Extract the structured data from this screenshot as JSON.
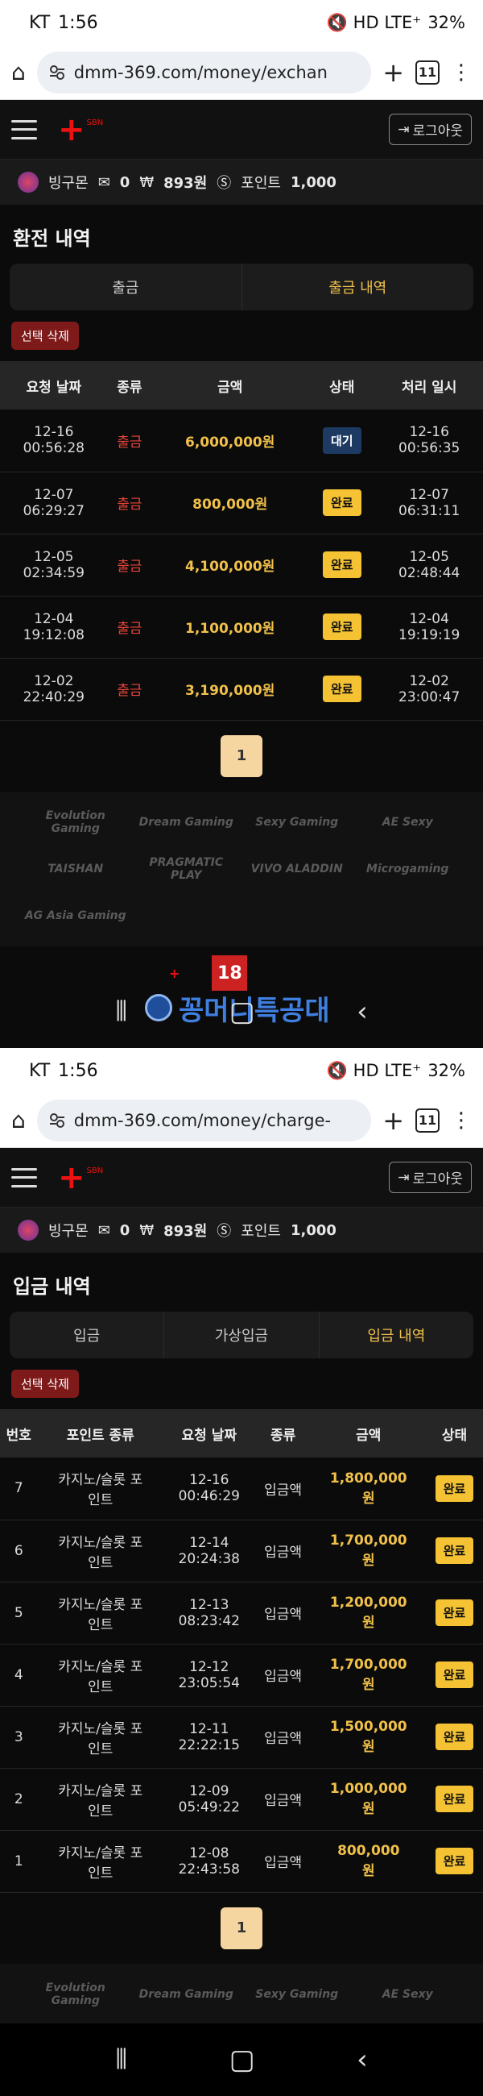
{
  "status_bar": {
    "screen1": {
      "carrier": "KT",
      "time": "1:56",
      "icons": "🔇 HD LTE⁺",
      "battery": "32%"
    },
    "screen2": {
      "carrier": "KT",
      "time": "1:56",
      "icons": "🔇 HD LTE⁺",
      "battery": "32%"
    }
  },
  "browser": {
    "screen1_url": "dmm-369.com/money/exchan",
    "screen2_url": "dmm-369.com/money/charge-",
    "tab_count": "11"
  },
  "header": {
    "logo_sub": "SBN",
    "logout_label": "로그아웃"
  },
  "user": {
    "name": "빙구몬",
    "messages": "0",
    "money": "893원",
    "point_label": "포인트",
    "points": "1,000"
  },
  "exchange": {
    "title": "환전 내역",
    "tabs": [
      "출금",
      "출금 내역"
    ],
    "delete_label": "선택 삭제",
    "columns": [
      "요청 날짜",
      "종류",
      "금액",
      "상태",
      "처리 일시"
    ],
    "rows": [
      {
        "req_date": "12-16",
        "req_time": "00:56:28",
        "type": "출금",
        "amount": "6,000,000원",
        "status": "대기",
        "done_date": "12-16",
        "done_time": "00:56:35"
      },
      {
        "req_date": "12-07",
        "req_time": "06:29:27",
        "type": "출금",
        "amount": "800,000원",
        "status": "완료",
        "done_date": "12-07",
        "done_time": "06:31:11"
      },
      {
        "req_date": "12-05",
        "req_time": "02:34:59",
        "type": "출금",
        "amount": "4,100,000원",
        "status": "완료",
        "done_date": "12-05",
        "done_time": "02:48:44"
      },
      {
        "req_date": "12-04",
        "req_time": "19:12:08",
        "type": "출금",
        "amount": "1,100,000원",
        "status": "완료",
        "done_date": "12-04",
        "done_time": "19:19:19"
      },
      {
        "req_date": "12-02",
        "req_time": "22:40:29",
        "type": "출금",
        "amount": "3,190,000원",
        "status": "완료",
        "done_date": "12-02",
        "done_time": "23:00:47"
      }
    ],
    "page": "1"
  },
  "deposit": {
    "title": "입금 내역",
    "tabs": [
      "입금",
      "가상입금",
      "입금 내역"
    ],
    "delete_label": "선택 삭제",
    "columns": [
      "번호",
      "포인트 종류",
      "요청 날짜",
      "종류",
      "금액",
      "상태"
    ],
    "rows": [
      {
        "no": "7",
        "kind1": "카지노/슬롯 포",
        "kind2": "인트",
        "date": "12-16",
        "time": "00:46:29",
        "type": "입금액",
        "amount1": "1,800,000",
        "amount2": "원",
        "status": "완료"
      },
      {
        "no": "6",
        "kind1": "카지노/슬롯 포",
        "kind2": "인트",
        "date": "12-14",
        "time": "20:24:38",
        "type": "입금액",
        "amount1": "1,700,000",
        "amount2": "원",
        "status": "완료"
      },
      {
        "no": "5",
        "kind1": "카지노/슬롯 포",
        "kind2": "인트",
        "date": "12-13",
        "time": "08:23:42",
        "type": "입금액",
        "amount1": "1,200,000",
        "amount2": "원",
        "status": "완료"
      },
      {
        "no": "4",
        "kind1": "카지노/슬롯 포",
        "kind2": "인트",
        "date": "12-12",
        "time": "23:05:54",
        "type": "입금액",
        "amount1": "1,700,000",
        "amount2": "원",
        "status": "완료"
      },
      {
        "no": "3",
        "kind1": "카지노/슬롯 포",
        "kind2": "인트",
        "date": "12-11",
        "time": "22:22:15",
        "type": "입금액",
        "amount1": "1,500,000",
        "amount2": "원",
        "status": "완료"
      },
      {
        "no": "2",
        "kind1": "카지노/슬롯 포",
        "kind2": "인트",
        "date": "12-09",
        "time": "05:49:22",
        "type": "입금액",
        "amount1": "1,000,000",
        "amount2": "원",
        "status": "완료"
      },
      {
        "no": "1",
        "kind1": "카지노/슬롯 포",
        "kind2": "인트",
        "date": "12-08",
        "time": "22:43:58",
        "type": "입금액",
        "amount1": "800,000",
        "amount2": "원",
        "status": "완료"
      }
    ],
    "page": "1"
  },
  "providers": [
    "Evolution Gaming",
    "Dream Gaming",
    "Sexy Gaming",
    "AE Sexy",
    "TAISHAN",
    "PRAGMATIC PLAY",
    "VIVO ALADDIN",
    "Microgaming",
    "AG Asia Gaming"
  ],
  "watermark": "꽁머니특공대",
  "colors": {
    "accent": "#f0c04a",
    "red": "#e6453a",
    "badge_ok": "#f4c233",
    "badge_wait": "#1d3a63",
    "delete": "#7e1a1a"
  }
}
